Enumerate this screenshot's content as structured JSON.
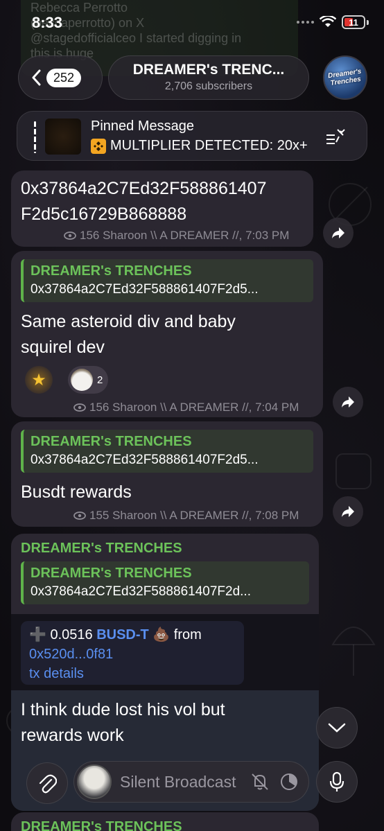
{
  "status_bar": {
    "time": "8:33",
    "battery": "11"
  },
  "background_ghost": {
    "line1": "Rebecca Perrotto",
    "line2": "(beccaperrotto) on X",
    "line3": "@stagedofficialceo I started digging in",
    "line4": "this is huge"
  },
  "header": {
    "back_count": "252",
    "title": "DREAMER's TRENC...",
    "subtitle": "2,706 subscribers",
    "avatar_text": "Dreamer's Trenches"
  },
  "pinned": {
    "title": "Pinned Message",
    "text": "MULTIPLIER DETECTED: 20x+"
  },
  "messages": [
    {
      "text_line1": "0x37864a2C7Ed32F588861407",
      "text_line2": "F2d5c16729B868888",
      "meta": "156 Sharoon \\\\ A DREAMER //, 7:03 PM"
    },
    {
      "reply_name": "DREAMER's TRENCHES",
      "reply_text": "0x37864a2C7Ed32F588861407F2d5...",
      "text_line1": "Same asteroid div and baby",
      "text_line2": "squirel dev",
      "reaction_count": "2",
      "meta": "156 Sharoon \\\\ A DREAMER //, 7:04 PM"
    },
    {
      "reply_name": "DREAMER's TRENCHES",
      "reply_text": "0x37864a2C7Ed32F588861407F2d5...",
      "text_line1": "Busdt rewards",
      "meta": "155 Sharoon \\\\ A DREAMER //, 7:08 PM"
    },
    {
      "sender": "DREAMER's TRENCHES",
      "reply_name": "DREAMER's TRENCHES",
      "reply_text": "0x37864a2C7Ed32F588861407F2d...",
      "embed_amount": "0.0516",
      "embed_token": "BUSD-T",
      "embed_from": "from",
      "embed_addr": "0x520d...0f81",
      "embed_link": "tx details",
      "text_line1": "I think dude lost his vol but",
      "text_line2": "rewards work"
    }
  ],
  "next_message": {
    "sender": "DREAMER's TRENCHES"
  },
  "input": {
    "placeholder": "Silent Broadcast"
  },
  "icons": [
    "back-chevron-icon",
    "pin-icon",
    "eye-icon",
    "forward-icon",
    "attach-icon",
    "bell-off-icon",
    "timer-icon",
    "mic-icon",
    "chevron-down-icon"
  ]
}
